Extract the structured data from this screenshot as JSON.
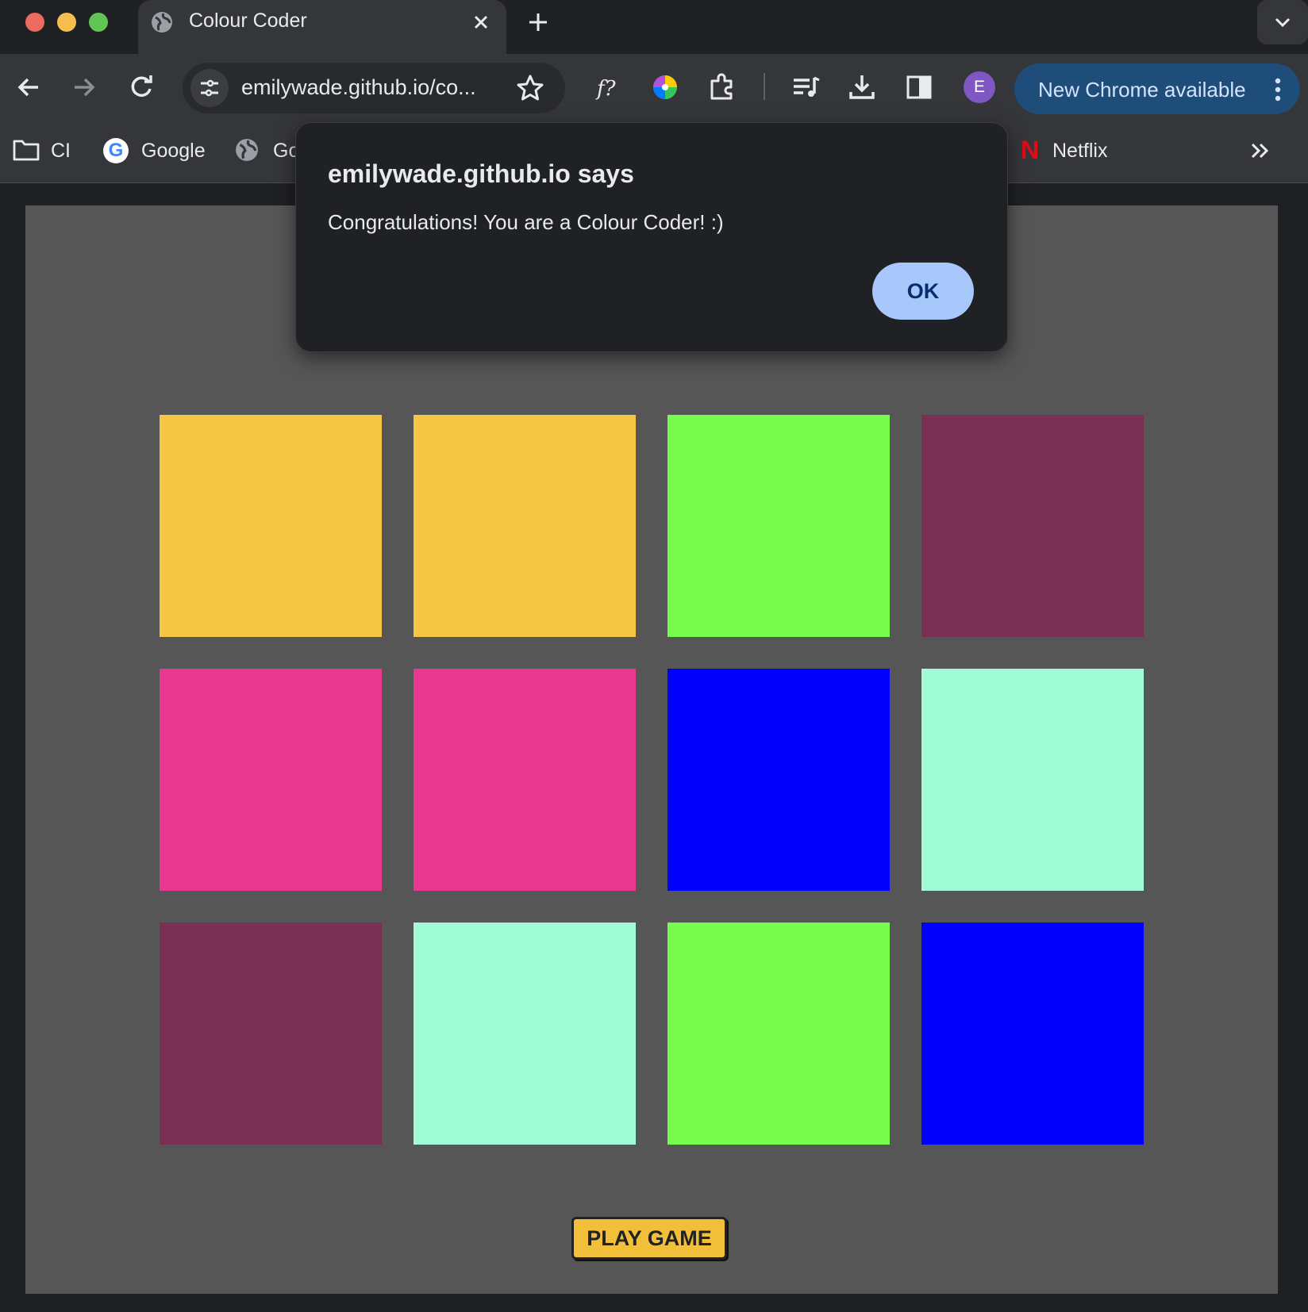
{
  "tabs": [
    {
      "title": "Colour Coder"
    }
  ],
  "toolbar": {
    "url": "emilywade.github.io/co...",
    "profile_initial": "E",
    "update_label": "New Chrome available"
  },
  "bookmarks": [
    {
      "label": "CI",
      "icon": "folder-icon"
    },
    {
      "label": "Google",
      "icon": "google-icon"
    },
    {
      "label": "Go",
      "icon": "globe-icon"
    },
    {
      "label": "Netflix",
      "icon": "netflix-icon"
    }
  ],
  "dialog": {
    "title": "emilywade.github.io says",
    "message": "Congratulations! You are a Colour Coder! :)",
    "ok_label": "OK"
  },
  "game": {
    "tile_colors": [
      "#f4c845",
      "#f4c845",
      "#77fc4d",
      "#783055",
      "#ea3890",
      "#ea3890",
      "#0000fb",
      "#a0fbd7",
      "#783055",
      "#a0fbd7",
      "#77fc4d",
      "#0000fb"
    ],
    "play_label": "PLAY GAME"
  }
}
